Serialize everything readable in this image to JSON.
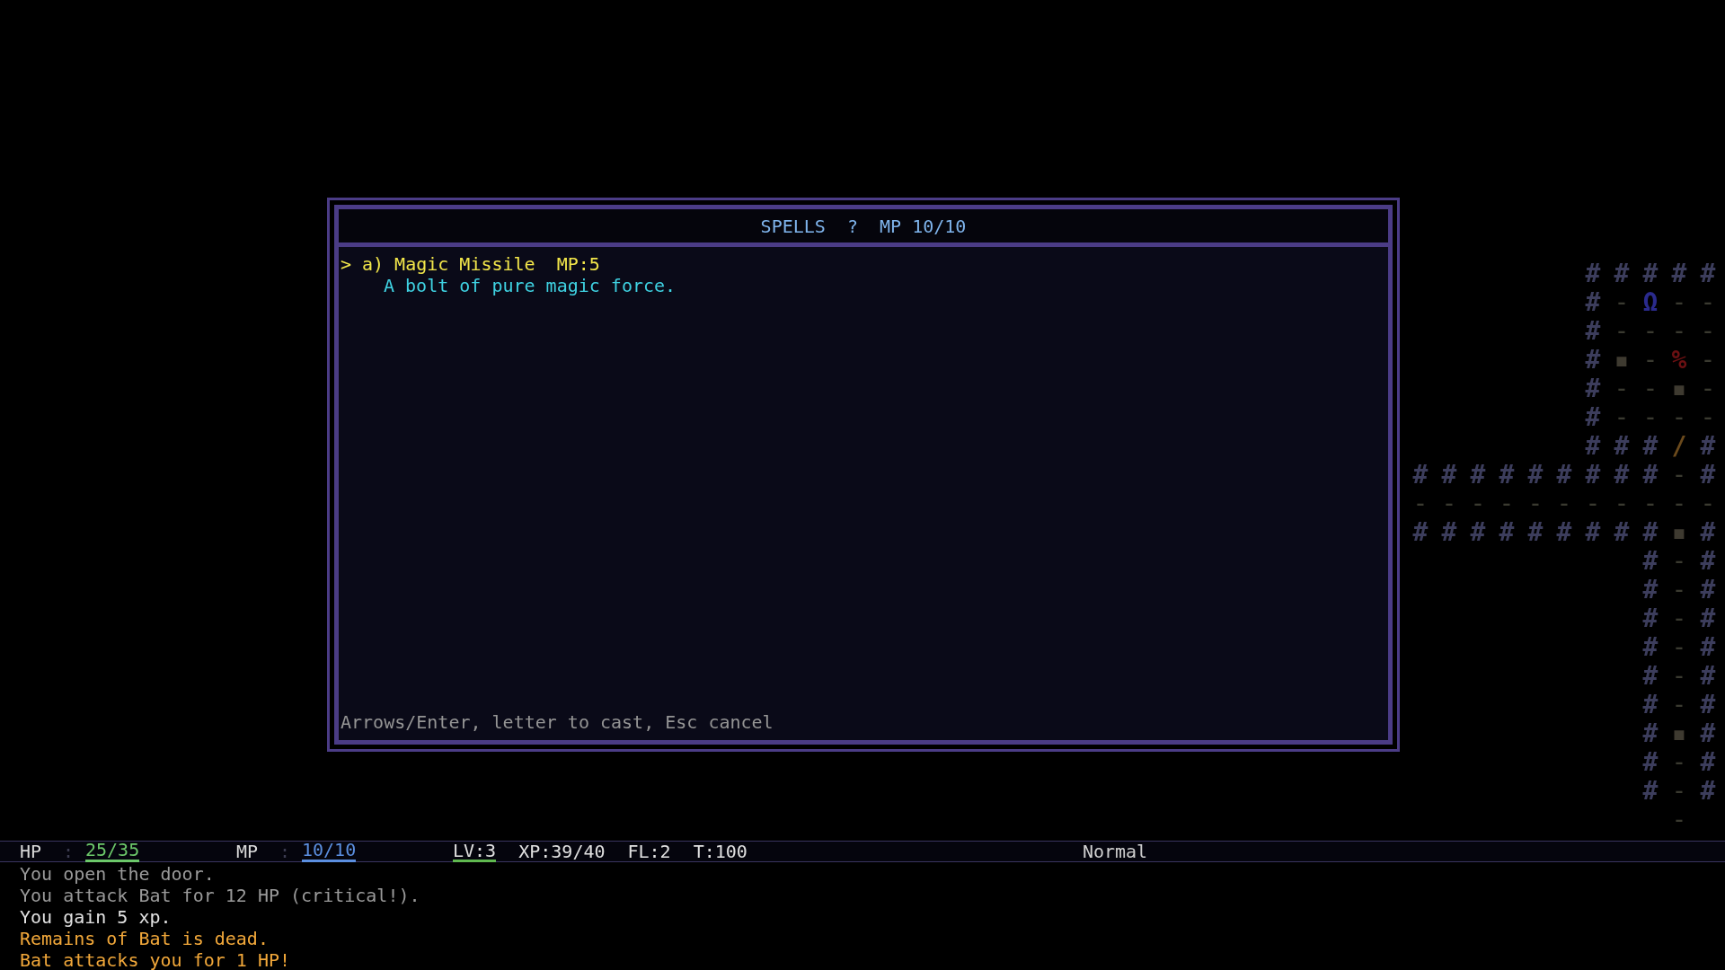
{
  "spell_dialog": {
    "title": "SPELLS  ?  MP 10/10",
    "spells": [
      {
        "cursor": ">",
        "label": "a) Magic Missile  MP:5",
        "description": "A bolt of pure magic force.",
        "selected": true
      }
    ],
    "footer": "Arrows/Enter, letter to cast, Esc cancel"
  },
  "map": {
    "rows": [
      [
        null,
        null,
        null,
        null,
        null,
        null,
        {
          "glyph": "#",
          "kind": "wall"
        },
        {
          "glyph": "#",
          "kind": "wall"
        },
        {
          "glyph": "#",
          "kind": "wall"
        },
        {
          "glyph": "#",
          "kind": "wall"
        },
        {
          "glyph": "#",
          "kind": "wall"
        }
      ],
      [
        null,
        null,
        null,
        null,
        null,
        null,
        {
          "glyph": "#",
          "kind": "wall"
        },
        {
          "glyph": "-",
          "kind": "floor"
        },
        {
          "glyph": "Ω",
          "kind": "feature"
        },
        {
          "glyph": "-",
          "kind": "floor"
        },
        {
          "glyph": "-",
          "kind": "floor"
        }
      ],
      [
        null,
        null,
        null,
        null,
        null,
        null,
        {
          "glyph": "#",
          "kind": "wall"
        },
        {
          "glyph": "-",
          "kind": "floor"
        },
        {
          "glyph": "-",
          "kind": "floor"
        },
        {
          "glyph": "-",
          "kind": "floor"
        },
        {
          "glyph": "-",
          "kind": "floor"
        }
      ],
      [
        null,
        null,
        null,
        null,
        null,
        null,
        {
          "glyph": "#",
          "kind": "wall"
        },
        {
          "glyph": "▪",
          "kind": "pebble"
        },
        {
          "glyph": "-",
          "kind": "floor"
        },
        {
          "glyph": "%",
          "kind": "corpse"
        },
        {
          "glyph": "-",
          "kind": "floor"
        }
      ],
      [
        null,
        null,
        null,
        null,
        null,
        null,
        {
          "glyph": "#",
          "kind": "wall"
        },
        {
          "glyph": "-",
          "kind": "floor"
        },
        {
          "glyph": "-",
          "kind": "floor"
        },
        {
          "glyph": "▪",
          "kind": "pebble"
        },
        {
          "glyph": "-",
          "kind": "floor"
        }
      ],
      [
        null,
        null,
        null,
        null,
        null,
        null,
        {
          "glyph": "#",
          "kind": "wall"
        },
        {
          "glyph": "-",
          "kind": "floor"
        },
        {
          "glyph": "-",
          "kind": "floor"
        },
        {
          "glyph": "-",
          "kind": "floor"
        },
        {
          "glyph": "-",
          "kind": "floor"
        }
      ],
      [
        null,
        null,
        null,
        null,
        null,
        null,
        {
          "glyph": "#",
          "kind": "wall"
        },
        {
          "glyph": "#",
          "kind": "wall"
        },
        {
          "glyph": "#",
          "kind": "wall"
        },
        {
          "glyph": "/",
          "kind": "door"
        },
        {
          "glyph": "#",
          "kind": "wall"
        }
      ],
      [
        {
          "glyph": "#",
          "kind": "wall"
        },
        {
          "glyph": "#",
          "kind": "wall"
        },
        {
          "glyph": "#",
          "kind": "wall"
        },
        {
          "glyph": "#",
          "kind": "wall"
        },
        {
          "glyph": "#",
          "kind": "wall"
        },
        {
          "glyph": "#",
          "kind": "wall"
        },
        {
          "glyph": "#",
          "kind": "wall"
        },
        {
          "glyph": "#",
          "kind": "wall"
        },
        {
          "glyph": "#",
          "kind": "wall"
        },
        {
          "glyph": "-",
          "kind": "floor"
        },
        {
          "glyph": "#",
          "kind": "wall"
        }
      ],
      [
        {
          "glyph": "-",
          "kind": "floor"
        },
        {
          "glyph": "-",
          "kind": "floor"
        },
        {
          "glyph": "-",
          "kind": "floor"
        },
        {
          "glyph": "-",
          "kind": "floor"
        },
        {
          "glyph": "-",
          "kind": "floor"
        },
        {
          "glyph": "-",
          "kind": "floor"
        },
        {
          "glyph": "-",
          "kind": "floor"
        },
        {
          "glyph": "-",
          "kind": "floor"
        },
        {
          "glyph": "-",
          "kind": "floor"
        },
        {
          "glyph": "-",
          "kind": "floor"
        },
        {
          "glyph": "-",
          "kind": "floor"
        }
      ],
      [
        {
          "glyph": "#",
          "kind": "wall"
        },
        {
          "glyph": "#",
          "kind": "wall"
        },
        {
          "glyph": "#",
          "kind": "wall"
        },
        {
          "glyph": "#",
          "kind": "wall"
        },
        {
          "glyph": "#",
          "kind": "wall"
        },
        {
          "glyph": "#",
          "kind": "wall"
        },
        {
          "glyph": "#",
          "kind": "wall"
        },
        {
          "glyph": "#",
          "kind": "wall"
        },
        {
          "glyph": "#",
          "kind": "wall"
        },
        {
          "glyph": "▪",
          "kind": "pebble"
        },
        {
          "glyph": "#",
          "kind": "wall"
        }
      ],
      [
        null,
        null,
        null,
        null,
        null,
        null,
        null,
        null,
        {
          "glyph": "#",
          "kind": "wall"
        },
        {
          "glyph": "-",
          "kind": "floor"
        },
        {
          "glyph": "#",
          "kind": "wall"
        }
      ],
      [
        null,
        null,
        null,
        null,
        null,
        null,
        null,
        null,
        {
          "glyph": "#",
          "kind": "wall"
        },
        {
          "glyph": "-",
          "kind": "floor"
        },
        {
          "glyph": "#",
          "kind": "wall"
        }
      ],
      [
        null,
        null,
        null,
        null,
        null,
        null,
        null,
        null,
        {
          "glyph": "#",
          "kind": "wall"
        },
        {
          "glyph": "-",
          "kind": "floor"
        },
        {
          "glyph": "#",
          "kind": "wall"
        }
      ],
      [
        null,
        null,
        null,
        null,
        null,
        null,
        null,
        null,
        {
          "glyph": "#",
          "kind": "wall"
        },
        {
          "glyph": "-",
          "kind": "floor"
        },
        {
          "glyph": "#",
          "kind": "wall"
        }
      ],
      [
        null,
        null,
        null,
        null,
        null,
        null,
        null,
        null,
        {
          "glyph": "#",
          "kind": "wall"
        },
        {
          "glyph": "-",
          "kind": "floor"
        },
        {
          "glyph": "#",
          "kind": "wall"
        }
      ],
      [
        null,
        null,
        null,
        null,
        null,
        null,
        null,
        null,
        {
          "glyph": "#",
          "kind": "wall"
        },
        {
          "glyph": "-",
          "kind": "floor"
        },
        {
          "glyph": "#",
          "kind": "wall"
        }
      ],
      [
        null,
        null,
        null,
        null,
        null,
        null,
        null,
        null,
        {
          "glyph": "#",
          "kind": "wall"
        },
        {
          "glyph": "▪",
          "kind": "pebble"
        },
        {
          "glyph": "#",
          "kind": "wall"
        }
      ],
      [
        null,
        null,
        null,
        null,
        null,
        null,
        null,
        null,
        {
          "glyph": "#",
          "kind": "wall"
        },
        {
          "glyph": "-",
          "kind": "floor"
        },
        {
          "glyph": "#",
          "kind": "wall"
        }
      ],
      [
        null,
        null,
        null,
        null,
        null,
        null,
        null,
        null,
        {
          "glyph": "#",
          "kind": "wall"
        },
        {
          "glyph": "-",
          "kind": "floor"
        },
        {
          "glyph": "#",
          "kind": "wall"
        }
      ],
      [
        null,
        null,
        null,
        null,
        null,
        null,
        null,
        null,
        null,
        {
          "glyph": "-",
          "kind": "floor"
        },
        null
      ]
    ]
  },
  "status_bar": {
    "items": [
      {
        "kind": "stat",
        "label": "HP",
        "separator": ":",
        "value": "25/35",
        "color": "#6cc86a"
      },
      {
        "kind": "stat",
        "label": "MP",
        "separator": ":",
        "value": "10/10",
        "color": "#5b8fe0"
      },
      {
        "kind": "level",
        "text": "LV:3",
        "color": "#5fb84f"
      },
      {
        "kind": "plain",
        "text": "XP:39/40"
      },
      {
        "kind": "plain",
        "text": "FL:2"
      },
      {
        "kind": "plain",
        "text": "T:100"
      }
    ],
    "mode": "Normal"
  },
  "message_log": [
    {
      "text": "You open the door.",
      "kind": "old"
    },
    {
      "text": "You attack Bat for 12 HP (critical!).",
      "kind": "old"
    },
    {
      "text": "You gain 5 xp.",
      "kind": "info"
    },
    {
      "text": "Remains of Bat is dead.",
      "kind": "alert"
    },
    {
      "text": "Bat attacks you for 1 HP!",
      "kind": "alert"
    }
  ]
}
